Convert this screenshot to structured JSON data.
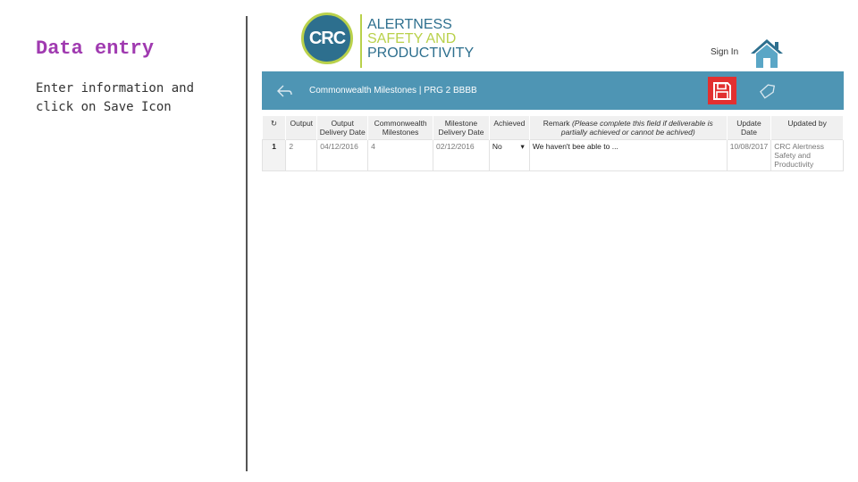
{
  "slide": {
    "title": "Data entry",
    "instruction": "Enter information and click on Save Icon"
  },
  "header": {
    "logo_abbr": "CRC",
    "logo_line1": "ALERTNESS",
    "logo_line2": "SAFETY AND",
    "logo_line3": "PRODUCTIVITY",
    "sign_in": "Sign In"
  },
  "toolbar": {
    "title": "Commonwealth Milestones | PRG 2 BBBB",
    "save_color": "#e23030",
    "bar_color": "#4e95b4"
  },
  "table": {
    "refresh_symbol": "↻",
    "columns": {
      "output": "Output",
      "output_delivery_date": "Output Delivery Date",
      "commonwealth_milestones": "Commonwealth Milestones",
      "milestone_delivery_date": "Milestone Delivery Date",
      "achieved": "Achieved",
      "remark": "Remark",
      "remark_note": "(Please complete this field if deliverable is partially achieved or cannot be achived)",
      "update_date": "Update Date",
      "updated_by": "Updated by"
    },
    "rows": [
      {
        "num": "1",
        "output": "2",
        "output_delivery_date": "04/12/2016",
        "commonwealth_milestones": "4",
        "milestone_delivery_date": "02/12/2016",
        "achieved": "No",
        "remark": "We haven't bee able to ...",
        "update_date": "10/08/2017",
        "updated_by": "CRC Alertness Safety and Productivity"
      }
    ]
  }
}
